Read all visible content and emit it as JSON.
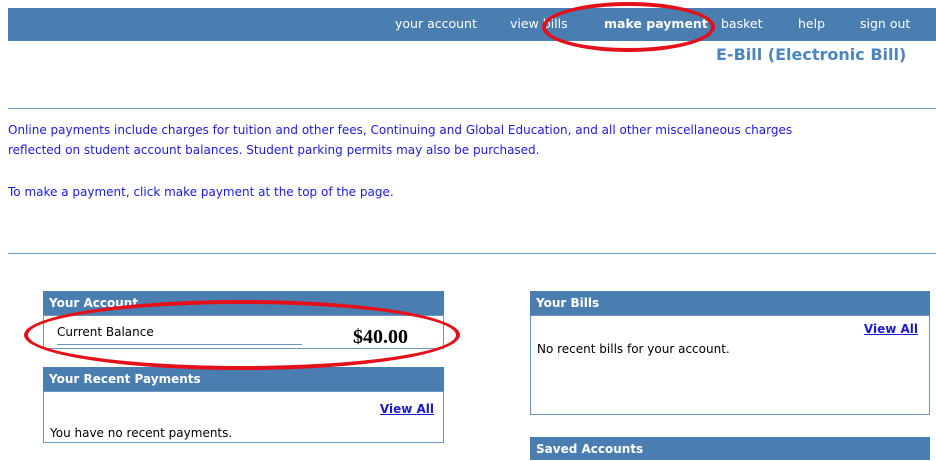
{
  "nav": {
    "items": [
      {
        "label": "your account"
      },
      {
        "label": "view bills"
      },
      {
        "label": "make payment"
      },
      {
        "label": "basket"
      },
      {
        "label": "help"
      },
      {
        "label": "sign out"
      }
    ],
    "active": "make payment"
  },
  "page_title": "E-Bill (Electronic Bill)",
  "intro": {
    "line1": "Online payments include charges for tuition and other fees, Continuing and Global Education, and all other miscellaneous charges",
    "line2": "reflected on student account balances.  Student parking permits may also be purchased.",
    "line3": "To make a payment, click make payment at the top of the page."
  },
  "your_account": {
    "header": "Your Account",
    "balance_label": "Current Balance",
    "balance_value": "$40.00"
  },
  "recent_payments": {
    "header": "Your Recent Payments",
    "view_all": "View All",
    "empty_text": "You have no recent payments."
  },
  "your_bills": {
    "header": "Your Bills",
    "view_all": "View All",
    "empty_text": "No recent bills for your account."
  },
  "saved_accounts": {
    "header": "Saved Accounts"
  },
  "colors": {
    "nav_bg": "#4a7eb1",
    "title": "#4a86c1",
    "intro_text": "#1a1af0",
    "highlight": "#e4111b"
  }
}
